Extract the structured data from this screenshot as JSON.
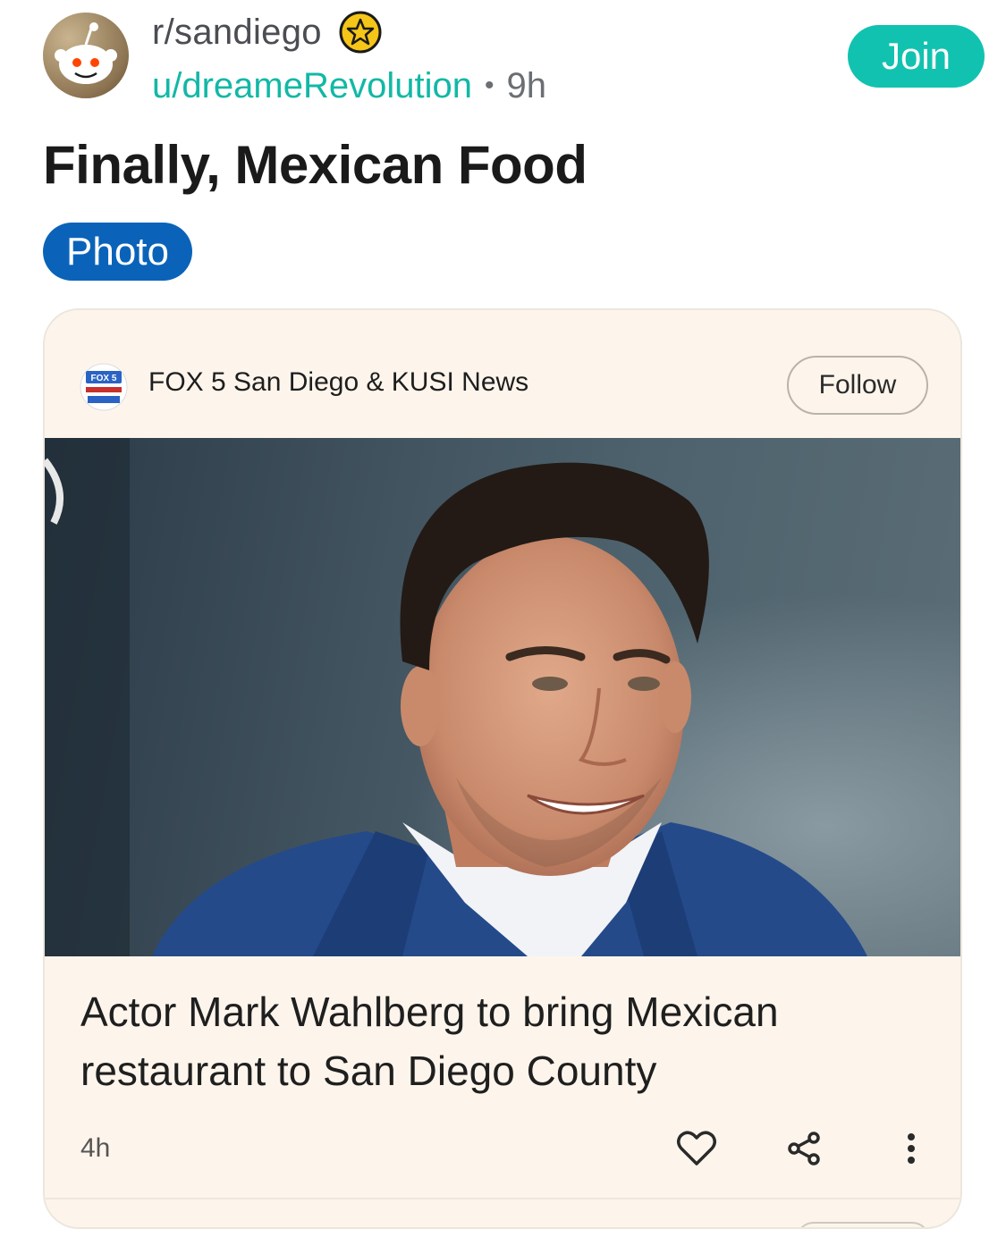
{
  "post": {
    "subreddit": "r/sandiego",
    "author": "u/dreameRevolution",
    "separator": "•",
    "age": "9h",
    "join_label": "Join",
    "title": "Finally, Mexican Food",
    "flair": "Photo"
  },
  "news_card": {
    "publisher_logo_text": "FOX 5",
    "publisher_name": "FOX 5 San Diego & KUSI News",
    "follow_label": "Follow",
    "headline": "Actor Mark Wahlberg to bring Mexican restaurant to San Diego County",
    "age": "4h",
    "actions": [
      "heart-icon",
      "share-icon",
      "more-icon"
    ]
  },
  "colors": {
    "join": "#12c2b0",
    "author": "#12b8a6",
    "flair": "#0a63b9",
    "card_bg": "#fdf5ec"
  }
}
